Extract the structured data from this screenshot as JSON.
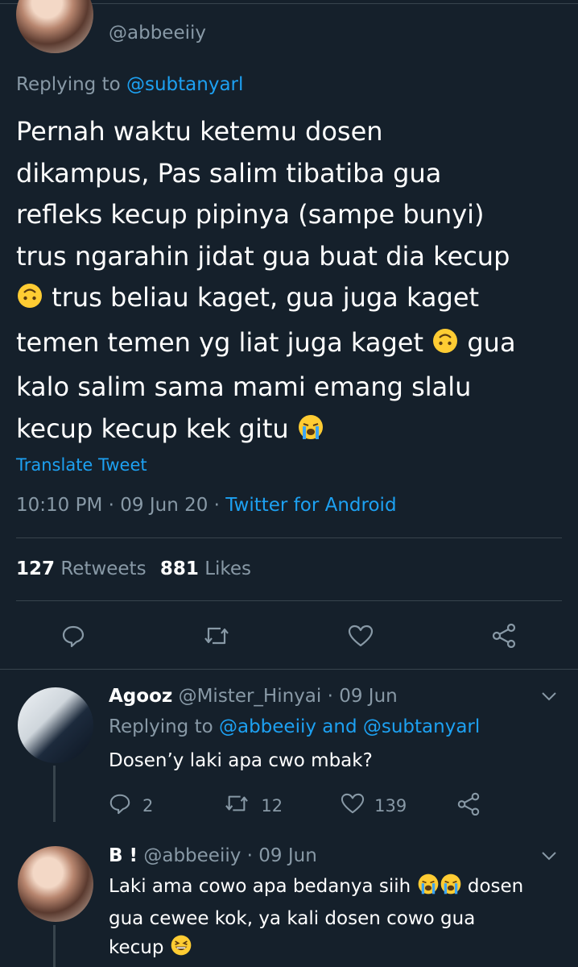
{
  "main_tweet": {
    "handle": "@abbeeiiy",
    "replying_label": "Replying to",
    "replying_to": "@subtanyarl",
    "lines": [
      {
        "text": "Pernah waktu ketemu dosen"
      },
      {
        "text": "dikampus, Pas salim tibatiba gua"
      },
      {
        "text": "refleks kecup pipinya (sampe bunyi)"
      },
      {
        "text": "trus ngarahin jidat gua buat dia kecup"
      },
      {
        "pre_emoji": "upside-down-face",
        "text": " trus beliau kaget, gua juga kaget"
      },
      {
        "text": "temen temen yg liat juga kaget ",
        "post_emoji": "upside-down-face",
        "after": " gua"
      },
      {
        "text": "kalo salim sama mami emang slalu"
      },
      {
        "text": "kecup kecup kek gitu ",
        "post_emoji": "loudly-crying-face"
      }
    ],
    "translate": "Translate Tweet",
    "time": "10:10 PM",
    "sep1": "·",
    "date": "09 Jun 20",
    "sep2": "·",
    "source": "Twitter for Android",
    "retweets_count": "127",
    "retweets_label": "Retweets",
    "likes_count": "881",
    "likes_label": "Likes"
  },
  "replies": [
    {
      "name": "Agooz",
      "handle": "@Mister_Hinyai",
      "dot": "·",
      "date": "09 Jun",
      "replying_label": "Replying to",
      "replying_to": "@abbeeiiy and @subtanyarl",
      "text": "Dosen’y laki apa cwo mbak?",
      "reply_count": "2",
      "retweet_count": "12",
      "like_count": "139"
    },
    {
      "name": "B !",
      "handle": "@abbeeiiy",
      "dot": "·",
      "date": "09 Jun",
      "line1": "Laki ama cowo apa bedanya siih ",
      "line1_after": " dosen",
      "line2": "gua cewee kok, ya kali dosen cowo gua",
      "line3": "kecup "
    }
  ],
  "colors": {
    "background": "#15202b",
    "text": "#ffffff",
    "muted": "#8899a6",
    "link": "#1da1f2",
    "divider": "#38444d"
  },
  "icons": [
    "reply-icon",
    "retweet-icon",
    "like-icon",
    "share-icon",
    "chevron-down-icon"
  ]
}
